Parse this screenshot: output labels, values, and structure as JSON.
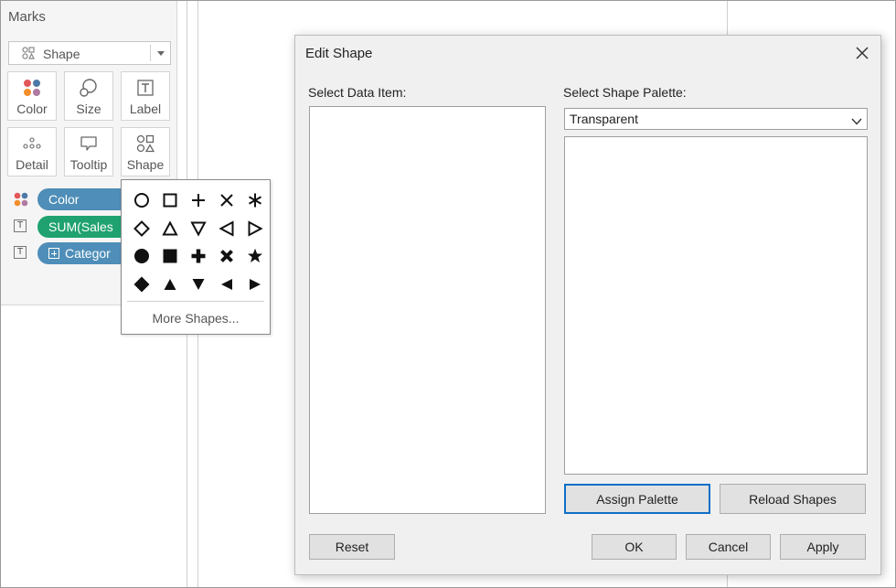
{
  "marks": {
    "title": "Marks",
    "mark_type": {
      "label": "Shape",
      "icon": "shape-icon"
    },
    "buttons": [
      {
        "label": "Color",
        "icon": "color-icon"
      },
      {
        "label": "Size",
        "icon": "size-icon"
      },
      {
        "label": "Label",
        "icon": "label-icon"
      },
      {
        "label": "Detail",
        "icon": "detail-icon"
      },
      {
        "label": "Tooltip",
        "icon": "tooltip-icon"
      },
      {
        "label": "Shape",
        "icon": "shape-icon"
      }
    ],
    "pills": [
      {
        "label": "Color",
        "icon": "color-icon",
        "color": "#4e8eb8"
      },
      {
        "label": "SUM(Sales",
        "icon": "label-icon",
        "color": "#1fa26f"
      },
      {
        "label": "Categor",
        "icon": "label-icon",
        "color": "#4e8eb8"
      }
    ]
  },
  "shape_popup": {
    "shapes": [
      "circle-outline-icon",
      "square-outline-icon",
      "plus-icon",
      "times-icon",
      "asterisk-icon",
      "diamond-outline-icon",
      "triangle-up-outline-icon",
      "triangle-down-outline-icon",
      "triangle-left-outline-icon",
      "triangle-right-outline-icon",
      "circle-filled-icon",
      "square-filled-icon",
      "plus-filled-icon",
      "times-filled-icon",
      "star-filled-icon",
      "diamond-filled-icon",
      "triangle-up-filled-icon",
      "triangle-down-filled-icon",
      "triangle-left-filled-icon",
      "triangle-right-filled-icon"
    ],
    "more_label": "More Shapes..."
  },
  "dialog": {
    "title": "Edit Shape",
    "select_data_item_label": "Select Data Item:",
    "select_palette_label": "Select Shape Palette:",
    "palette_value": "Transparent",
    "assign_palette": "Assign Palette",
    "reload_shapes": "Reload Shapes",
    "reset": "Reset",
    "ok": "OK",
    "cancel": "Cancel",
    "apply": "Apply"
  },
  "colors": {
    "pill_blue": "#4e8eb8",
    "pill_green": "#1fa26f",
    "focus_border": "#0f6fc6"
  }
}
